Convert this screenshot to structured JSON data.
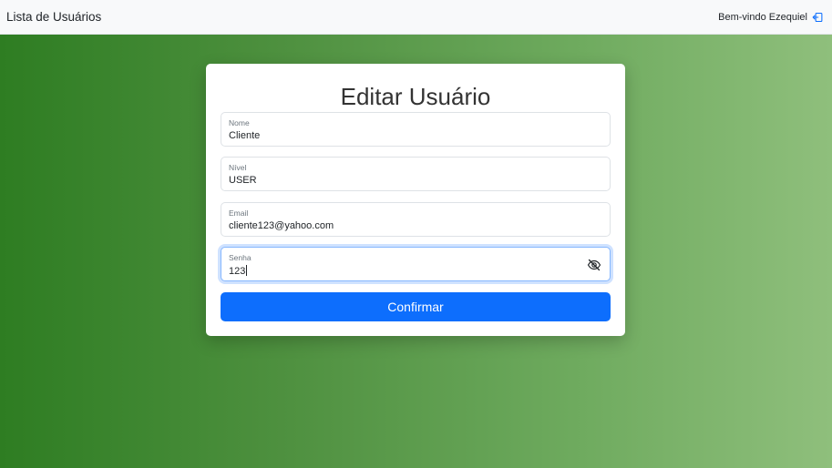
{
  "navbar": {
    "brand": "Lista de Usuários",
    "welcome": "Bem-vindo Ezequiel",
    "logout_icon": "logout-icon"
  },
  "form": {
    "title": "Editar Usuário",
    "fields": [
      {
        "label": "Nome",
        "value": "Cliente"
      },
      {
        "label": "Nível",
        "value": "USER"
      },
      {
        "label": "Email",
        "value": "cliente123@yahoo.com"
      },
      {
        "label": "Senha",
        "value": "123"
      }
    ],
    "password_toggle_icon": "eye-slash-icon",
    "submit_label": "Confirmar"
  },
  "colors": {
    "primary": "#0d6efd",
    "background_gradient_start": "#2e7d22",
    "background_gradient_end": "#8fbf7c"
  }
}
